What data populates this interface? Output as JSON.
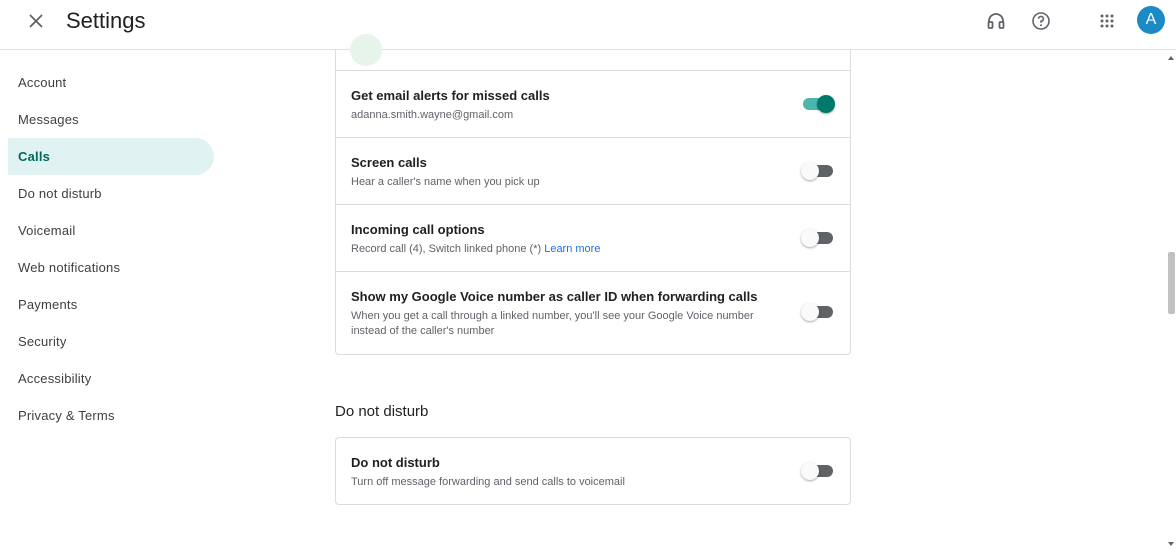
{
  "header": {
    "title": "Settings",
    "avatar_letter": "A"
  },
  "icons": {
    "close": "close-icon",
    "support": "headset-icon",
    "help": "help-icon",
    "apps": "apps-grid-icon"
  },
  "sidebar": {
    "items": [
      {
        "label": "Account"
      },
      {
        "label": "Messages"
      },
      {
        "label": "Calls",
        "active": true
      },
      {
        "label": "Do not disturb"
      },
      {
        "label": "Voicemail"
      },
      {
        "label": "Web notifications"
      },
      {
        "label": "Payments"
      },
      {
        "label": "Security"
      },
      {
        "label": "Accessibility"
      },
      {
        "label": "Privacy & Terms"
      }
    ]
  },
  "calls": {
    "rows": [
      {
        "title": "Get email alerts for missed calls",
        "sub": "adanna.smith.wayne@gmail.com",
        "on": true
      },
      {
        "title": "Screen calls",
        "sub": "Hear a caller's name when you pick up",
        "on": false
      },
      {
        "title": "Incoming call options",
        "sub": "Record call (4), Switch linked phone (*)",
        "link": "Learn more",
        "on": false
      },
      {
        "title": "Show my Google Voice number as caller ID when forwarding calls",
        "sub": "When you get a call through a linked number, you'll see your Google Voice number instead of the caller's number",
        "on": false
      }
    ]
  },
  "dnd": {
    "section_title": "Do not disturb",
    "row": {
      "title": "Do not disturb",
      "sub": "Turn off message forwarding and send calls to voicemail",
      "on": false
    }
  },
  "colors": {
    "accent": "#00796b",
    "active_nav_bg": "#e0f2f1",
    "avatar_bg": "#1a8bc5",
    "link": "#1a73e8"
  }
}
